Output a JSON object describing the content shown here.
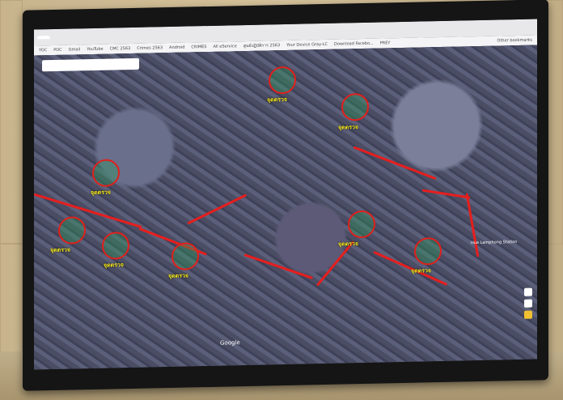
{
  "browser": {
    "tab_title": "",
    "bookmarks": [
      "YOC",
      "POC",
      "Gmail",
      "YouTube",
      "CMC 2563",
      "Crimes 2563",
      "Android",
      "CRIMES",
      "All eService",
      "ศูนย์ปฏิบัติการ 2563",
      "Your Device Gray-LC",
      "Download Facebo...",
      "PREY"
    ],
    "other_bookmarks": "Other bookmarks"
  },
  "map": {
    "provider": "Google",
    "station_label": "Hua Lamphong Station",
    "markers": [
      {
        "label": "จุดตรวจ"
      },
      {
        "label": "จุดตรวจ"
      },
      {
        "label": "จุดตรวจ"
      },
      {
        "label": "จุดตรวจ"
      },
      {
        "label": "จุดตรวจ"
      },
      {
        "label": "จุดตรวจ"
      },
      {
        "label": "จุดตรวจ"
      },
      {
        "label": "จุดตรวจ"
      }
    ]
  },
  "colors": {
    "route": "#e61e1e",
    "marker": "#e0201c",
    "label": "#f2e51c"
  }
}
